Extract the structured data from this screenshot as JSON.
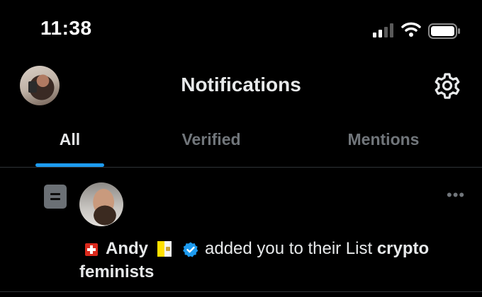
{
  "status_bar": {
    "time": "11:38",
    "signal_icon": "cellular-signal-icon",
    "wifi_icon": "wifi-icon",
    "battery_icon": "battery-icon"
  },
  "header": {
    "title": "Notifications",
    "settings_icon": "gear-icon"
  },
  "tabs": [
    {
      "label": "All",
      "active": true
    },
    {
      "label": "Verified",
      "active": false
    },
    {
      "label": "Mentions",
      "active": false
    }
  ],
  "notification": {
    "type_icon": "list-icon",
    "user_name": "Andy",
    "verified": true,
    "action_text": "added you to their List",
    "list_name_part1": "crypto",
    "list_name_part2": "feminists",
    "more_label": "•••"
  },
  "colors": {
    "accent": "#1d9bf0",
    "background": "#000000",
    "muted_text": "#71767b"
  }
}
